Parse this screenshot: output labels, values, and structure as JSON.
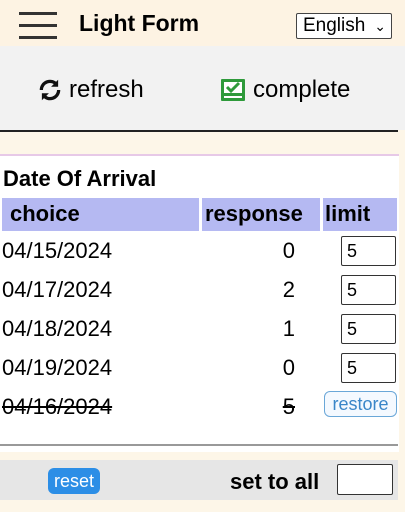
{
  "header": {
    "title": "Light Form",
    "language": "English"
  },
  "toolbar": {
    "refresh_label": "refresh",
    "complete_label": "complete"
  },
  "section": {
    "title": "Date Of Arrival",
    "columns": [
      "choice",
      "response",
      "limit"
    ],
    "rows": [
      {
        "date": "04/15/2024",
        "response": "0",
        "limit": "5"
      },
      {
        "date": "04/17/2024",
        "response": "2",
        "limit": "5"
      },
      {
        "date": "04/18/2024",
        "response": "1",
        "limit": "5"
      },
      {
        "date": "04/19/2024",
        "response": "0",
        "limit": "5"
      },
      {
        "date": "04/16/2024",
        "response": "5",
        "restore_label": "restore"
      }
    ]
  },
  "footer": {
    "reset_label": "reset",
    "set_to_all_label": "set to all",
    "set_to_all_value": ""
  },
  "colors": {
    "header_bg": "#fdf3e3",
    "table_header_bg": "#b5b9f2",
    "refresh_icon": "#111111",
    "complete_icon": "#2e9a3a",
    "reset_button": "#2c8ee6",
    "restore_button_text": "#3a86c8"
  }
}
